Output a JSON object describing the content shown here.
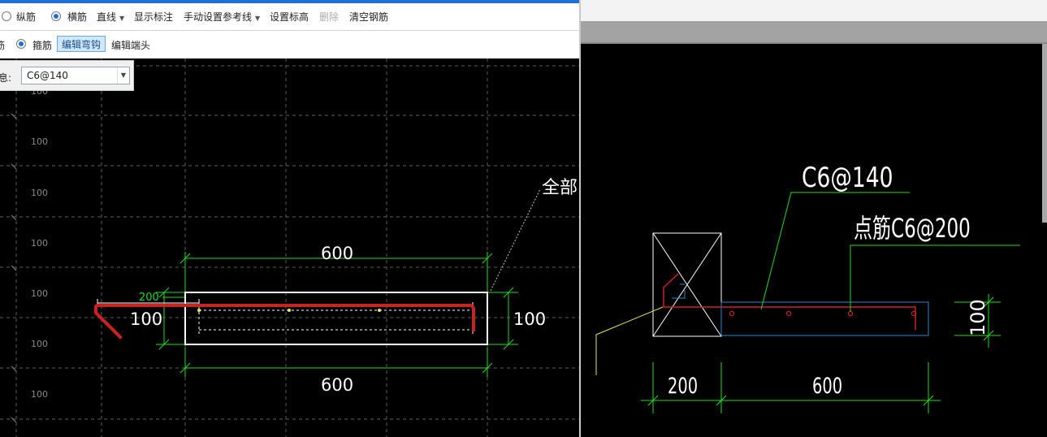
{
  "toolbar1": {
    "radio_longitudinal": "纵筋",
    "radio_transverse": "横筋",
    "line_menu": "直线",
    "show_dimensions": "显示标注",
    "manual_ref_line": "手动设置参考线",
    "set_elevation": "设置标高",
    "delete": "删除",
    "clear_rebar": "清空钢筋"
  },
  "toolbar2": {
    "cut_label": "筋",
    "radio_stirrup": "箍筋",
    "edit_hook": "编辑弯钩",
    "edit_end": "编辑端头"
  },
  "info_bar": {
    "label": "信息:",
    "value": "C6@140"
  },
  "left_canvas": {
    "grid_labels": [
      "100",
      "100",
      "100",
      "100",
      "100",
      "100",
      "100"
    ],
    "dim_top": "600",
    "dim_bottom": "600",
    "dim_left": "100",
    "dim_right": "100",
    "dim_small": "200",
    "callout": "全部"
  },
  "right_canvas": {
    "rebar_label": "C6@140",
    "dist_rebar_label": "点筋C6@200",
    "dim_200": "200",
    "dim_600": "600",
    "dim_100": "100"
  },
  "colors": {
    "rebar_red": "#cc2222",
    "dim_green": "#22dd22",
    "outline_white": "#ffffff",
    "slab_cyan": "#2a8ad0",
    "leader_yellow": "#e8e85a",
    "grid": "#6a6a6a",
    "accent_blue": "#1e6fd9"
  }
}
